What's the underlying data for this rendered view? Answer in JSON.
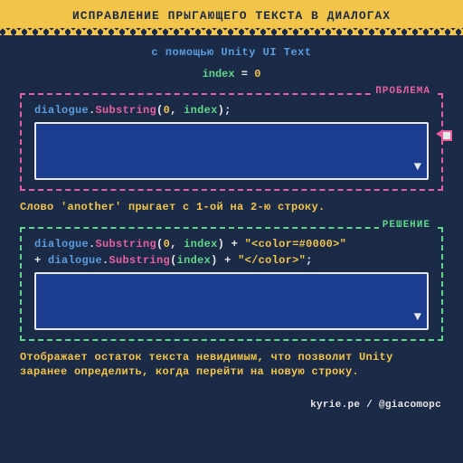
{
  "header": {
    "title": "ИСПРАВЛЕНИЕ ПРЫГАЮЩЕГО ТЕКСТА В ДИАЛОГАХ"
  },
  "subtitle": "с помощью Unity UI Text",
  "index_line": {
    "label": "index",
    "equals": " = ",
    "value": "0"
  },
  "panels": {
    "problem": {
      "label": "ПРОБЛЕМА",
      "code_tokens": [
        {
          "t": "dialogue",
          "c": "tok-cyan"
        },
        {
          "t": ".",
          "c": "tok-white"
        },
        {
          "t": "Substring",
          "c": "tok-pink"
        },
        {
          "t": "(",
          "c": "tok-white"
        },
        {
          "t": "0",
          "c": "tok-yellow"
        },
        {
          "t": ", ",
          "c": "tok-white"
        },
        {
          "t": "index",
          "c": "tok-green"
        },
        {
          "t": ");",
          "c": "tok-white"
        }
      ],
      "caption": "Слово 'another' прыгает с 1-ой на 2-ю строку."
    },
    "solution": {
      "label": "РЕШЕНИЕ",
      "code_tokens_line1": [
        {
          "t": "dialogue",
          "c": "tok-cyan"
        },
        {
          "t": ".",
          "c": "tok-white"
        },
        {
          "t": "Substring",
          "c": "tok-pink"
        },
        {
          "t": "(",
          "c": "tok-white"
        },
        {
          "t": "0",
          "c": "tok-yellow"
        },
        {
          "t": ", ",
          "c": "tok-white"
        },
        {
          "t": "index",
          "c": "tok-green"
        },
        {
          "t": ") + ",
          "c": "tok-white"
        },
        {
          "t": "\"<color=#0000>\"",
          "c": "tok-yellow"
        }
      ],
      "code_tokens_line2": [
        {
          "t": "+ ",
          "c": "tok-white"
        },
        {
          "t": "dialogue",
          "c": "tok-cyan"
        },
        {
          "t": ".",
          "c": "tok-white"
        },
        {
          "t": "Substring",
          "c": "tok-pink"
        },
        {
          "t": "(",
          "c": "tok-white"
        },
        {
          "t": "index",
          "c": "tok-green"
        },
        {
          "t": ") + ",
          "c": "tok-white"
        },
        {
          "t": "\"</color>\"",
          "c": "tok-yellow"
        },
        {
          "t": ";",
          "c": "tok-white"
        }
      ],
      "caption": "Отображает остаток текста невидимым, что позволит Unity заранее определить, когда перейти на новую строку."
    }
  },
  "advance_glyph": "▼",
  "credit": "kyrie.pe / @giacomopc"
}
